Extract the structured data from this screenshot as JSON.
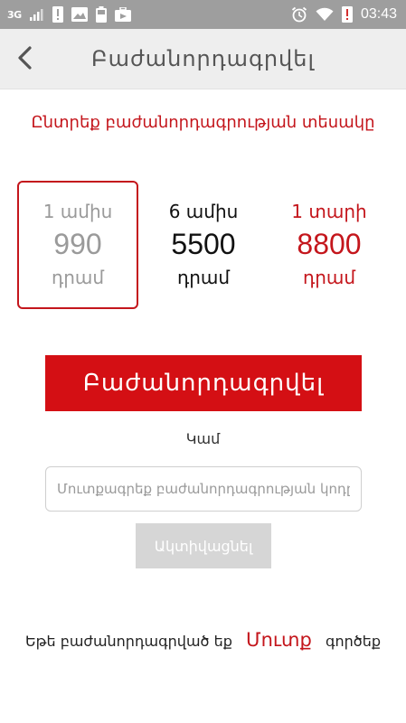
{
  "status_bar": {
    "network": "3G",
    "time": "03:43",
    "colors": {
      "background": "#9e9e9e",
      "icon": "#ffffff",
      "alert": "#d32f2f"
    },
    "icons": [
      "signal-icon",
      "alert-icon",
      "image-icon",
      "battery-icon",
      "briefcase-icon",
      "alarm-icon",
      "wifi-icon",
      "sim-alert-icon"
    ]
  },
  "header": {
    "title": "Բաժանորդագրվել",
    "back_icon": "chevron-left-icon"
  },
  "subtitle": "Ընտրեք բաժանորդագրության տեսակը",
  "plans": [
    {
      "period": "1 ամիս",
      "price": "990",
      "currency": "դրամ",
      "selected": true,
      "color": "#9a9a9a"
    },
    {
      "period": "6 ամիս",
      "price": "5500",
      "currency": "դրամ",
      "selected": false,
      "color": "#111111"
    },
    {
      "period": "1 տարի",
      "price": "8800",
      "currency": "դրամ",
      "selected": false,
      "color": "#c4161c"
    }
  ],
  "subscribe_button": "Բաժանորդագրվել",
  "or_text": "Կամ",
  "code_input": {
    "value": "",
    "placeholder": "Մուտքագրեք բաժանորդագրության կոդը"
  },
  "activate_button": "Ակտիվացնել",
  "footer": {
    "prefix": "Եթե բաժանորդագրված եք",
    "link": "Մուտք",
    "suffix": "գործեք"
  },
  "colors": {
    "accent": "#c4161c",
    "button": "#d40f14",
    "toolbar": "#eeeeee",
    "disabled_button": "#d6d6d6"
  }
}
